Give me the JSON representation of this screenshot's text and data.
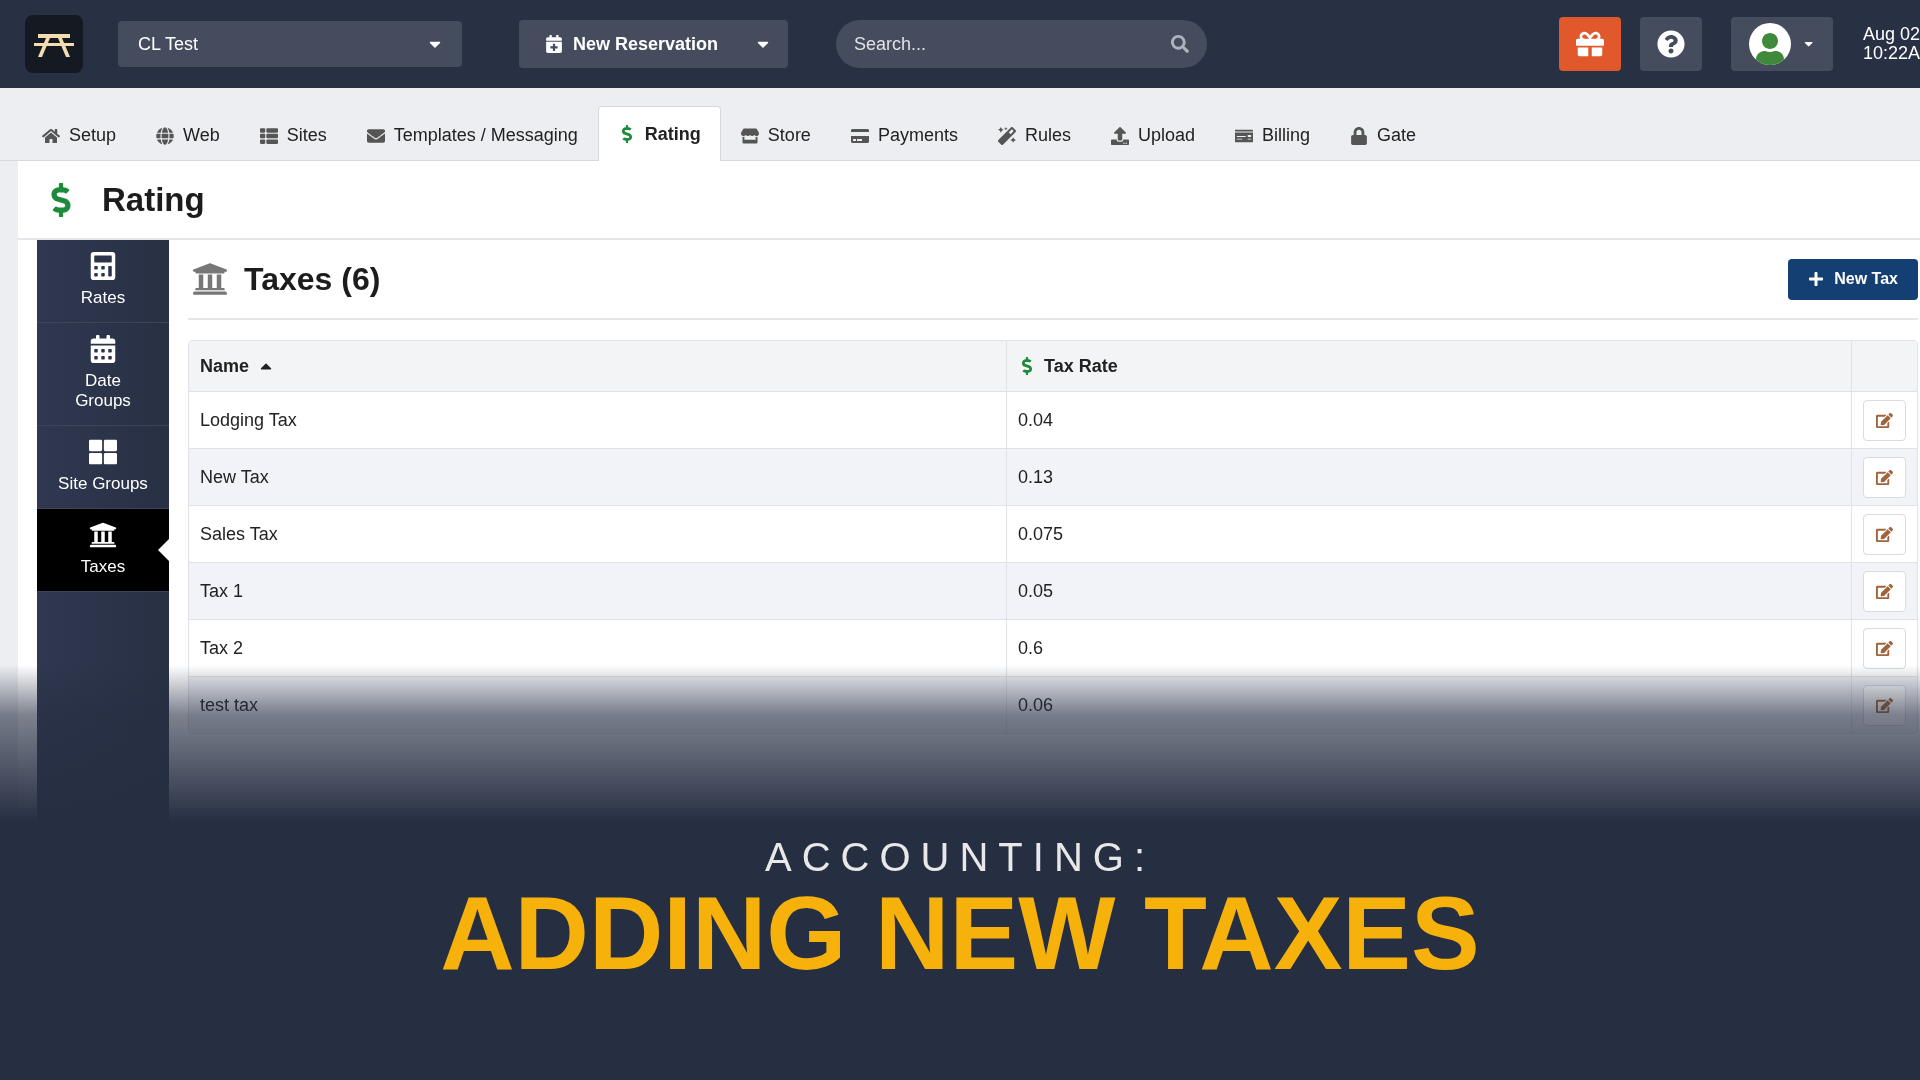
{
  "topbar": {
    "location": "CL Test",
    "reservation_button": "New Reservation",
    "search": {
      "placeholder": "Search..."
    },
    "date": "Aug 02",
    "time": "10:22A"
  },
  "tabs": [
    {
      "kind": "home",
      "label": "Setup",
      "selected": false
    },
    {
      "kind": "globe",
      "label": "Web",
      "selected": false
    },
    {
      "kind": "list",
      "label": "Sites",
      "selected": false
    },
    {
      "kind": "envelope",
      "label": "Templates / Messaging",
      "selected": false
    },
    {
      "kind": "dollar",
      "label": "Rating",
      "selected": true
    },
    {
      "kind": "store",
      "label": "Store",
      "selected": false
    },
    {
      "kind": "card",
      "label": "Payments",
      "selected": false
    },
    {
      "kind": "wand",
      "label": "Rules",
      "selected": false
    },
    {
      "kind": "upload",
      "label": "Upload",
      "selected": false
    },
    {
      "kind": "check",
      "label": "Billing",
      "selected": false
    },
    {
      "kind": "lock",
      "label": "Gate",
      "selected": false
    }
  ],
  "page_title": "Rating",
  "sidebar": {
    "items": [
      {
        "kind": "calculator",
        "label": "Rates",
        "selected": false
      },
      {
        "kind": "calendar",
        "label": "Date Groups",
        "selected": false
      },
      {
        "kind": "grid",
        "label": "Site Groups",
        "selected": false
      },
      {
        "kind": "bank",
        "label": "Taxes",
        "selected": true
      }
    ]
  },
  "panel": {
    "title": "Taxes (6)",
    "new_button": "New Tax"
  },
  "table": {
    "columns": [
      "Name",
      "Tax Rate"
    ],
    "rows": [
      [
        "Lodging Tax",
        "0.04"
      ],
      [
        "New Tax",
        "0.13"
      ],
      [
        "Sales Tax",
        "0.075"
      ],
      [
        "Tax 1",
        "0.05"
      ],
      [
        "Tax 2",
        "0.6"
      ],
      [
        "test tax",
        "0.06"
      ]
    ]
  },
  "overlay": {
    "kicker": "ACCOUNTING:",
    "headline": "ADDING NEW TAXES"
  }
}
